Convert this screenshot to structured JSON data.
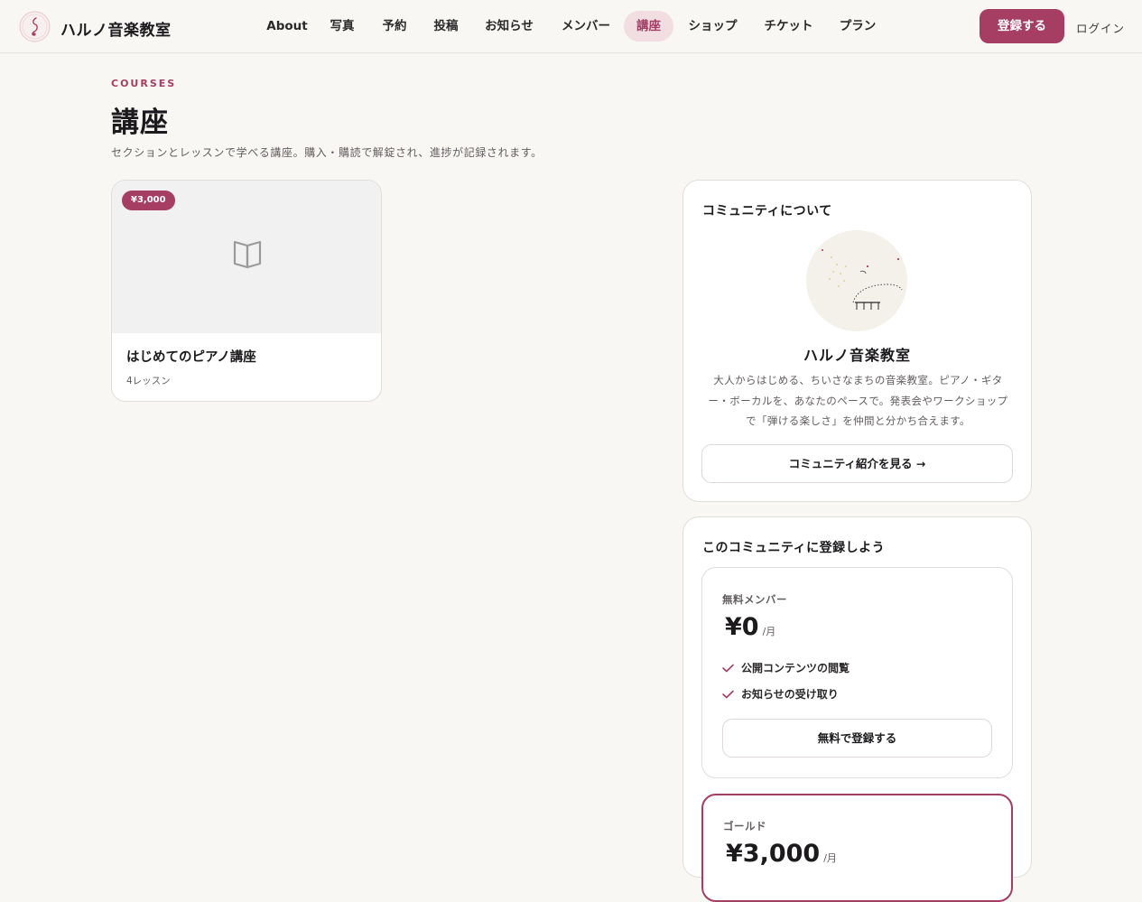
{
  "header": {
    "brand": "ハルノ音楽教室",
    "nav": [
      {
        "label": "About",
        "active": false
      },
      {
        "label": "写真",
        "active": false
      },
      {
        "label": "予約",
        "active": false
      },
      {
        "label": "投稿",
        "active": false
      },
      {
        "label": "お知らせ",
        "active": false
      },
      {
        "label": "メンバー",
        "active": false
      },
      {
        "label": "講座",
        "active": true
      },
      {
        "label": "ショップ",
        "active": false
      },
      {
        "label": "チケット",
        "active": false
      },
      {
        "label": "プラン",
        "active": false
      }
    ],
    "register_label": "登録する",
    "login_label": "ログイン"
  },
  "page": {
    "eyebrow": "COURSES",
    "title": "講座",
    "description": "セクションとレッスンで学べる講座。購入・購読で解錠され、進捗が記録されます。"
  },
  "courses": [
    {
      "price": "¥3,000",
      "title": "はじめてのピアノ講座",
      "meta": "4レッスン",
      "thumbnail_icon": "book-open-icon"
    }
  ],
  "about": {
    "heading": "コミュニティについて",
    "name": "ハルノ音楽教室",
    "description": "大人からはじめる、ちいさなまちの音楽教室。ピアノ・ギター・ボーカルを、あなたのペースで。発表会やワークショップで「弾ける楽しさ」を仲間と分かち合えます。",
    "button_label": "コミュニティ紹介を見る →"
  },
  "join": {
    "heading": "このコミュニティに登録しよう",
    "plans": [
      {
        "name": "無料メンバー",
        "price": "¥0",
        "unit": "/月",
        "features": [
          "公開コンテンツの閲覧",
          "お知らせの受け取り"
        ],
        "button_label": "無料で登録する"
      },
      {
        "name": "ゴールド",
        "price": "¥3,000",
        "unit": "/月",
        "features": [],
        "button_label": ""
      }
    ]
  },
  "colors": {
    "accent": "#a63d63",
    "accent_soft": "#f1dde2",
    "background": "#f9f7f4",
    "text": "#1c1a1d",
    "muted": "#625d60",
    "border": "#e2ddd9"
  }
}
